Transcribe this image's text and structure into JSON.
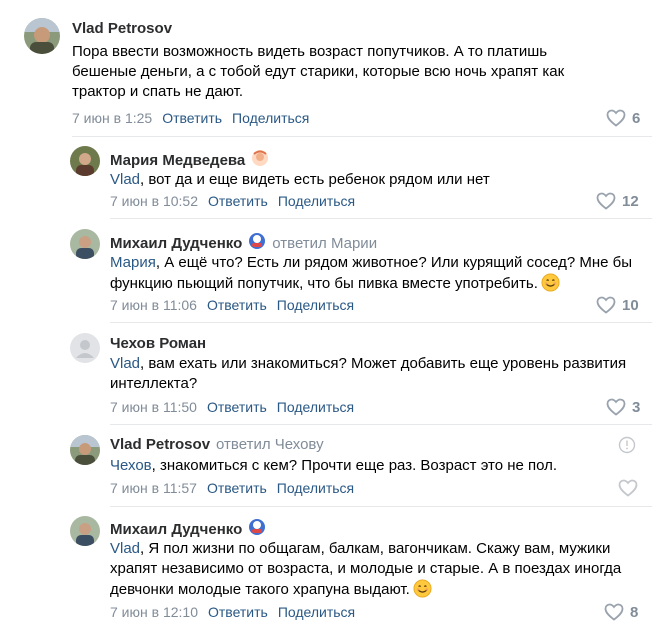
{
  "comments": [
    {
      "author": "Vlad Petrosov",
      "replied_to": "",
      "text": "Пора ввести возможность видеть возраст попутчиков. А то платишь бешеные деньги, а с тобой едут старики, которые всю ночь храпят как трактор и спать не дают.",
      "mention": "",
      "time": "7 июн в 1:25",
      "reply_label": "Ответить",
      "share_label": "Поделиться",
      "likes": "6"
    },
    {
      "author": "Мария Медведева",
      "replied_to": "",
      "mention": "Vlad",
      "text": ", вот да и еще видеть есть ребенок рядом или нет",
      "time": "7 июн в 10:52",
      "reply_label": "Ответить",
      "share_label": "Поделиться",
      "likes": "12"
    },
    {
      "author": "Михаил Дудченко",
      "replied_to": "ответил Марии",
      "mention": "Мария",
      "text": ", А ещё что? Есть ли рядом животное? Или курящий сосед? Мне бы функцию пьющий попутчик, что бы пивка вместе употребить.",
      "time": "7 июн в 11:06",
      "reply_label": "Ответить",
      "share_label": "Поделиться",
      "likes": "10"
    },
    {
      "author": "Чехов Роман",
      "replied_to": "",
      "mention": "Vlad",
      "text": ", вам ехать или знакомиться? Может добавить еще уровень развития интеллекта?",
      "time": "7 июн в 11:50",
      "reply_label": "Ответить",
      "share_label": "Поделиться",
      "likes": "3"
    },
    {
      "author": "Vlad Petrosov",
      "replied_to": "ответил Чехову",
      "mention": "Чехов",
      "text": ", знакомиться с кем? Прочти еще раз. Возраст это не пол.",
      "time": "7 июн в 11:57",
      "reply_label": "Ответить",
      "share_label": "Поделиться",
      "likes": ""
    },
    {
      "author": "Михаил Дудченко",
      "replied_to": "",
      "mention": "Vlad",
      "text": ", Я пол жизни по общагам, балкам, вагончикам. Скажу вам, мужики храпят независимо от возраста, и молодые и старые. А в поездах иногда девчонки молодые такого храпуна выдают.",
      "time": "7 июн в 12:10",
      "reply_label": "Ответить",
      "share_label": "Поделиться",
      "likes": "8"
    }
  ],
  "icons": {
    "like": "heart-outline-icon",
    "info": "info-circle-icon",
    "emoji": "smiling-face-emoji",
    "badge": "avatar-badge-icon"
  },
  "colors": {
    "link": "#2a5885",
    "meta": "#818c99",
    "divider": "#e7e8ec"
  }
}
